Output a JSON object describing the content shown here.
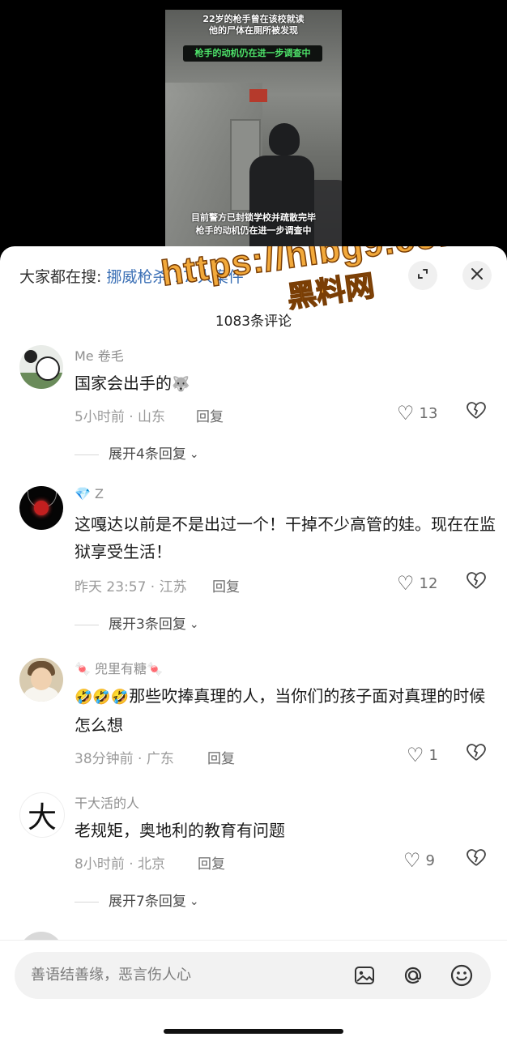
{
  "video": {
    "caption_line1": "22岁的枪手曾在该校就读",
    "caption_line2": "他的尸体在厕所被发现",
    "highlight": "枪手的动机仍在进一步调查中",
    "bottom_line1": "目前警方已封锁学校并疏散完毕",
    "bottom_line2": "枪手的动机仍在进一步调查中"
  },
  "header": {
    "search_label": "大家都在搜:",
    "search_keyword": "挪威枪杀 77 人案件",
    "comment_count": "1083条评论",
    "collapse_icon": "collapse-icon",
    "close_icon": "close-icon"
  },
  "watermark": {
    "url": "https://hlbg9.com",
    "name": "黑料网"
  },
  "comments": [
    {
      "username": "Me 卷毛",
      "text": "国家会出手的",
      "emoji": "🐺",
      "time": "5小时前",
      "location": "山东",
      "reply": "回复",
      "likes": "13",
      "expand": "展开4条回复"
    },
    {
      "username_prefix": "💎",
      "username": "Z",
      "text": "这嘎达以前是不是出过一个！干掉不少高管的娃。现在在监狱享受生活！",
      "time": "昨天 23:57",
      "location": "江苏",
      "reply": "回复",
      "likes": "12",
      "expand": "展开3条回复"
    },
    {
      "username_prefix": "🍬",
      "username": "兜里有糖",
      "username_suffix": "🍬",
      "emoji": "🤣🤣🤣",
      "text": "那些吹捧真理的人，当你们的孩子面对真理的时候怎么想",
      "time": "38分钟前",
      "location": "广东",
      "reply": "回复",
      "likes": "1"
    },
    {
      "username": "干大活的人",
      "avatar_char": "大",
      "text": "老规矩，奥地利的教育有问题",
      "time": "8小时前",
      "location": "北京",
      "reply": "回复",
      "likes": "9",
      "expand": "展开7条回复"
    }
  ],
  "input": {
    "placeholder": "善语结善缘，恶言伤人心",
    "icons": [
      "image-icon",
      "at-icon",
      "emoji-icon"
    ]
  }
}
